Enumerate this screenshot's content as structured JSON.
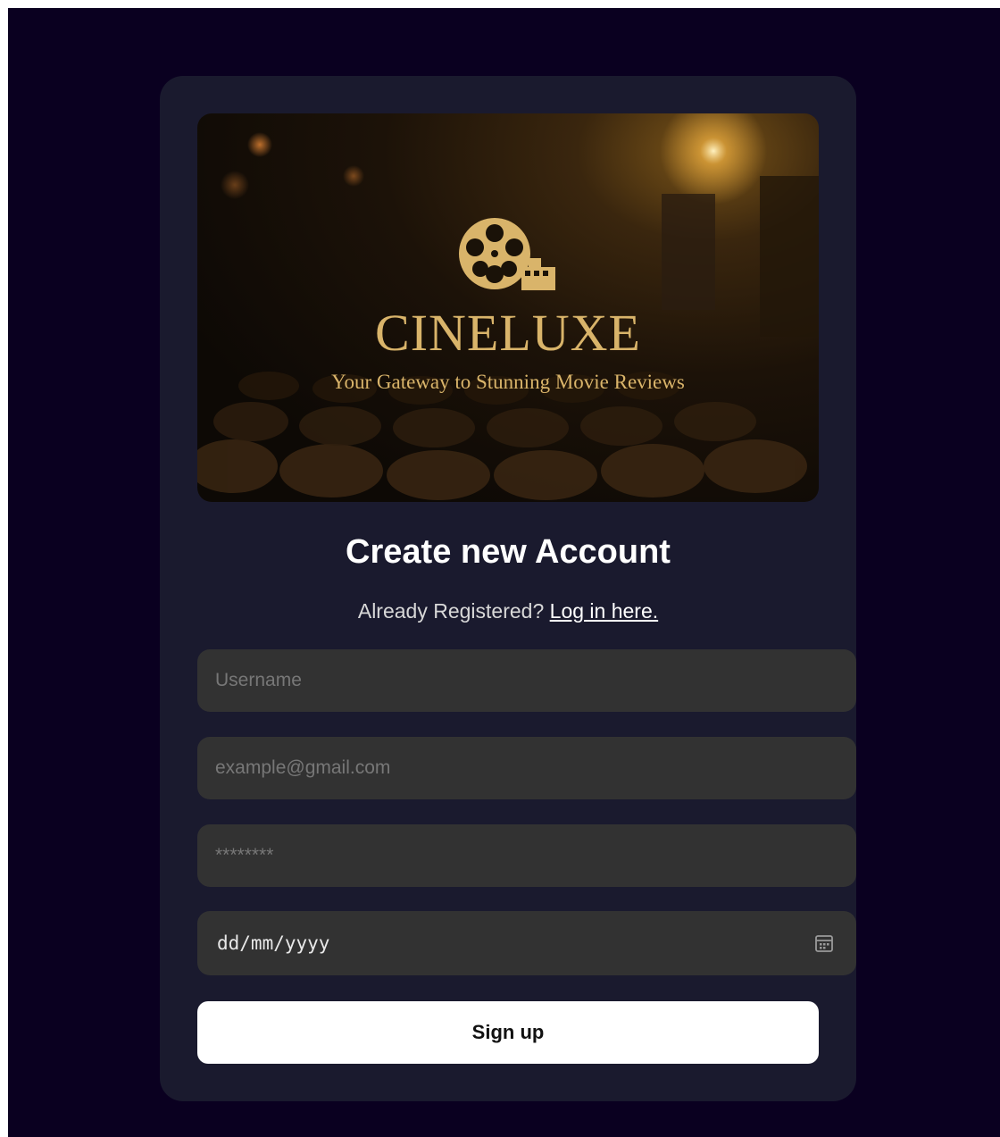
{
  "hero": {
    "brand": "CINELUXE",
    "tagline": "Your Gateway to Stunning Movie Reviews",
    "logo_icon": "film-reel-icon"
  },
  "form": {
    "title": "Create new Account",
    "already_text": "Already Registered? ",
    "login_link": "Log in here.",
    "username_placeholder": "Username",
    "email_placeholder": "example@gmail.com",
    "password_placeholder": "********",
    "date_placeholder": "dd/mm/yyyy",
    "calendar_icon": "calendar-icon",
    "submit_label": "Sign up"
  },
  "colors": {
    "page_background": "#0a0020",
    "card_background": "#1a1a2e",
    "input_background": "#323232",
    "brand_gold": "#d9b46a",
    "button_background": "#ffffff"
  }
}
